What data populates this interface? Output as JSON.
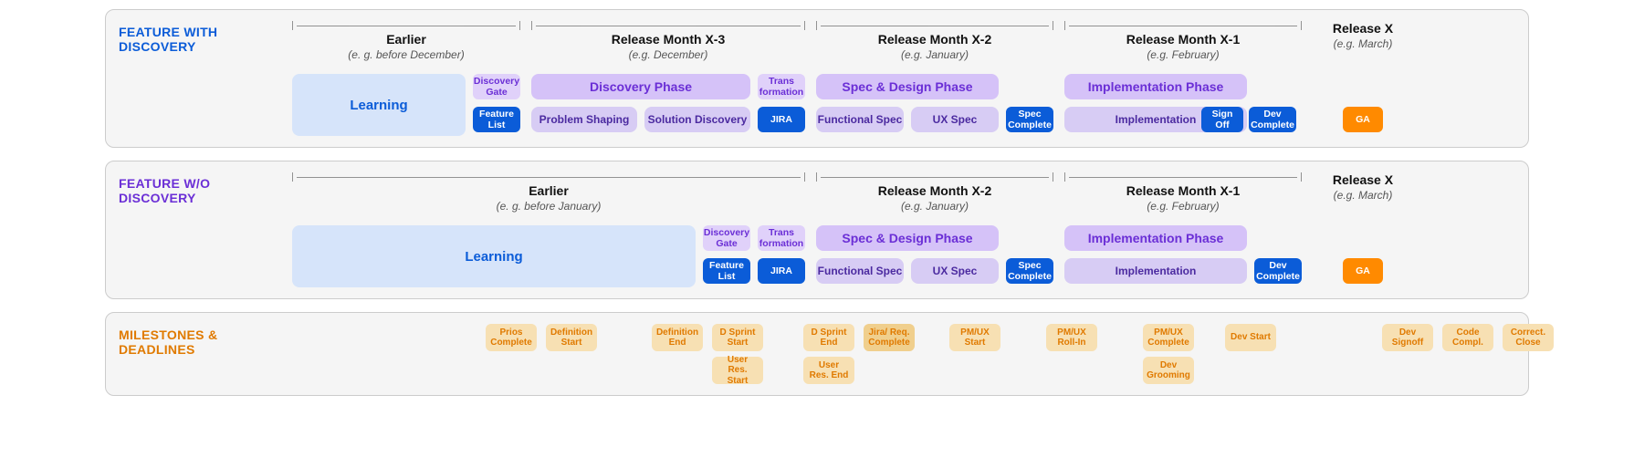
{
  "panels": {
    "with_discovery": {
      "title": "FEATURE WITH DISCOVERY",
      "timeline": {
        "earlier": {
          "title": "Earlier",
          "sub": "(e. g. before December)"
        },
        "x3": {
          "title": "Release Month X-3",
          "sub": "(e.g. December)"
        },
        "x2": {
          "title": "Release Month X-2",
          "sub": "(e.g. January)"
        },
        "x1": {
          "title": "Release Month X-1",
          "sub": "(e.g. February)"
        },
        "x": {
          "title": "Release X",
          "sub": "(e.g. March)"
        }
      },
      "learning": "Learning",
      "chips": {
        "discovery_gate": "Discovery Gate",
        "feature_list": "Feature List",
        "transformation": "Trans formation",
        "jira": "JIRA",
        "spec_complete": "Spec Complete",
        "sign_off": "Sign Off",
        "dev_complete": "Dev Complete",
        "ga": "GA"
      },
      "phases": {
        "discovery": {
          "header": "Discovery Phase",
          "sub1": "Problem Shaping",
          "sub2": "Solution Discovery"
        },
        "spec": {
          "header": "Spec & Design Phase",
          "sub1": "Functional Spec",
          "sub2": "UX Spec"
        },
        "impl": {
          "header": "Implementation Phase",
          "sub1": "Implementation"
        }
      }
    },
    "without_discovery": {
      "title": "FEATURE W/O DISCOVERY",
      "timeline": {
        "earlier": {
          "title": "Earlier",
          "sub": "(e. g. before January)"
        },
        "x2": {
          "title": "Release Month X-2",
          "sub": "(e.g. January)"
        },
        "x1": {
          "title": "Release Month X-1",
          "sub": "(e.g. February)"
        },
        "x": {
          "title": "Release X",
          "sub": "(e.g. March)"
        }
      },
      "learning": "Learning",
      "chips": {
        "discovery_gate": "Discovery Gate",
        "feature_list": "Feature List",
        "transformation": "Trans formation",
        "jira": "JIRA",
        "spec_complete": "Spec Complete",
        "dev_complete": "Dev Complete",
        "ga": "GA"
      },
      "phases": {
        "spec": {
          "header": "Spec & Design Phase",
          "sub1": "Functional Spec",
          "sub2": "UX Spec"
        },
        "impl": {
          "header": "Implementation Phase",
          "sub1": "Implementation"
        }
      }
    },
    "milestones": {
      "title": "MILESTONES & DEADLINES",
      "items": {
        "prios_complete": "Prios Complete",
        "definition_start": "Definition Start",
        "definition_end": "Definition End",
        "d_sprint_start": "D Sprint Start",
        "user_res_start": "User Res. Start",
        "d_sprint_end": "D Sprint End",
        "user_res_end": "User Res. End",
        "jira_req_complete": "Jira/ Req. Complete",
        "pmux_start": "PM/UX Start",
        "pmux_rollin": "PM/UX Roll-In",
        "pmux_complete": "PM/UX Complete",
        "dev_grooming": "Dev Grooming",
        "dev_start": "Dev Start",
        "dev_signoff": "Dev Signoff",
        "code_compl": "Code Compl.",
        "correct_close": "Correct. Close"
      }
    }
  }
}
